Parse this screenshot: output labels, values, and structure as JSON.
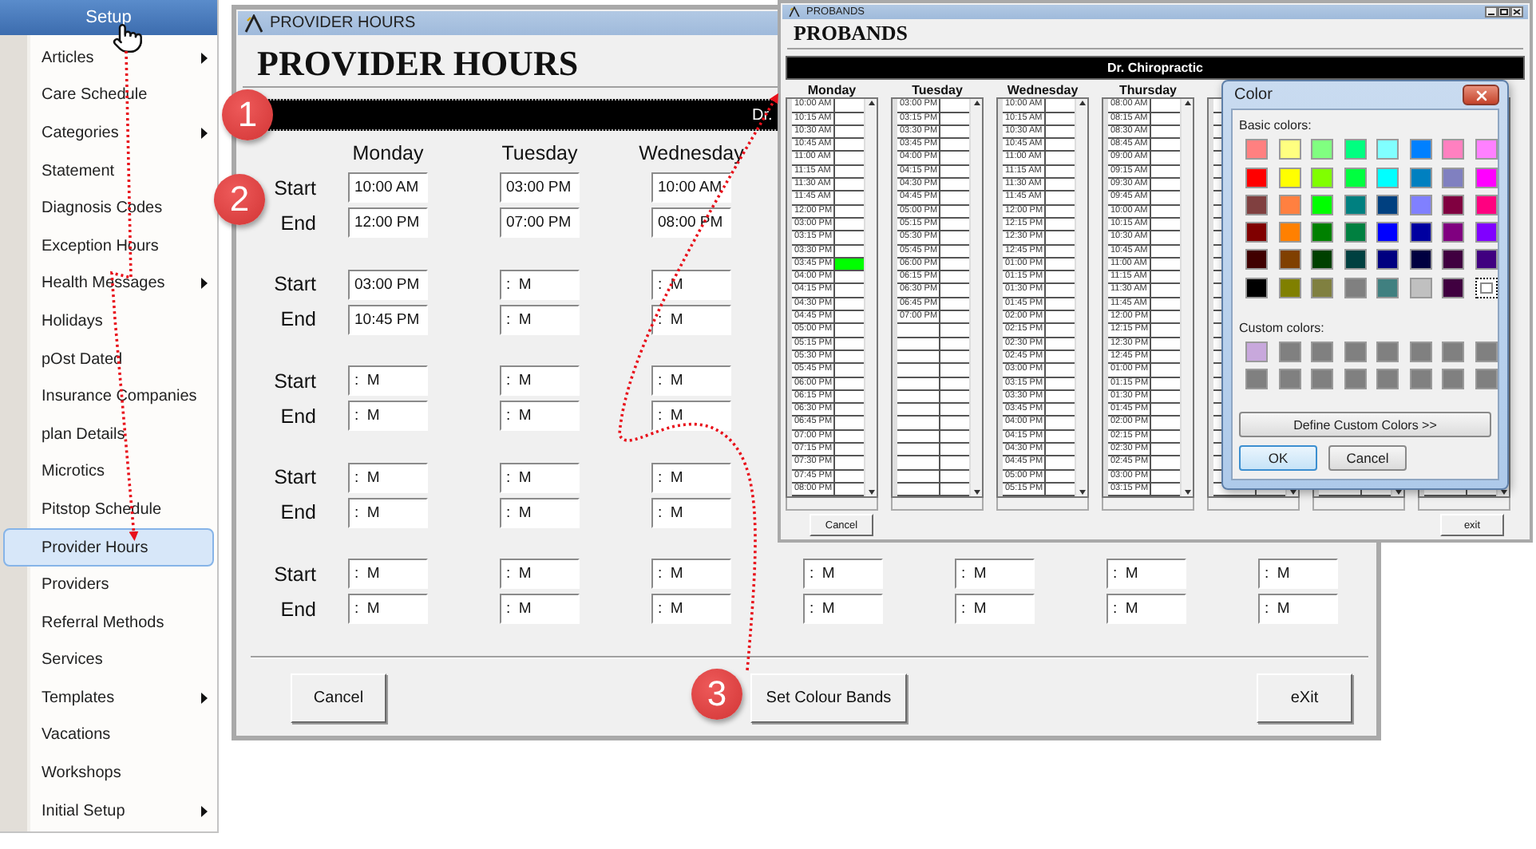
{
  "menu": {
    "title": "Setup",
    "items": [
      {
        "label": "Articles",
        "submenu": true,
        "selected": false
      },
      {
        "label": "Care Schedule",
        "submenu": false,
        "selected": false
      },
      {
        "label": "Categories",
        "submenu": true,
        "selected": false
      },
      {
        "label": "Statement",
        "submenu": false,
        "selected": false
      },
      {
        "label": "Diagnosis Codes",
        "submenu": false,
        "selected": false
      },
      {
        "label": "Exception Hours",
        "submenu": false,
        "selected": false
      },
      {
        "label": "Health Messages",
        "submenu": true,
        "selected": false
      },
      {
        "label": "Holidays",
        "submenu": false,
        "selected": false
      },
      {
        "label": "pOst Dated",
        "submenu": false,
        "selected": false
      },
      {
        "label": "Insurance Companies",
        "submenu": false,
        "selected": false
      },
      {
        "label": "plan Details",
        "submenu": false,
        "selected": false
      },
      {
        "label": "Microtics",
        "submenu": false,
        "selected": false
      },
      {
        "label": "Pitstop Schedule",
        "submenu": false,
        "selected": false
      },
      {
        "label": "Provider Hours",
        "submenu": false,
        "selected": true
      },
      {
        "label": "Providers",
        "submenu": false,
        "selected": false
      },
      {
        "label": "Referral Methods",
        "submenu": false,
        "selected": false
      },
      {
        "label": "Services",
        "submenu": false,
        "selected": false
      },
      {
        "label": "Templates",
        "submenu": true,
        "selected": false
      },
      {
        "label": "Vacations",
        "submenu": false,
        "selected": false
      },
      {
        "label": "Workshops",
        "submenu": false,
        "selected": false
      },
      {
        "label": "Initial Setup",
        "submenu": true,
        "selected": false
      }
    ]
  },
  "provider_hours": {
    "window_title": "PROVIDER HOURS",
    "heading": "PROVIDER HOURS",
    "band_text": "Dr.",
    "days": [
      "Monday",
      "Tuesday",
      "Wednesday"
    ],
    "slots": [
      {
        "start_label": "Start",
        "end_label": "End",
        "start": [
          "10:00 AM",
          "03:00 PM",
          "10:00 AM"
        ],
        "end": [
          "12:00 PM",
          "07:00 PM",
          "08:00 PM"
        ]
      },
      {
        "start_label": "Start",
        "end_label": "End",
        "start": [
          "03:00 PM",
          ":  M",
          ":  M"
        ],
        "end": [
          "10:45 PM",
          ":  M",
          ":  M"
        ]
      },
      {
        "start_label": "Start",
        "end_label": "End",
        "start": [
          ":  M",
          ":  M",
          ":  M"
        ],
        "end": [
          ":  M",
          ":  M",
          ":  M"
        ]
      },
      {
        "start_label": "Start",
        "end_label": "End",
        "start": [
          ":  M",
          ":  M",
          ":  M"
        ],
        "end": [
          ":  M",
          ":  M",
          ":  M"
        ]
      },
      {
        "start_label": "Start",
        "end_label": "End",
        "start": [
          ":  M",
          ":  M",
          ":  M",
          ":  M",
          ":  M",
          ":  M",
          ":  M"
        ],
        "end": [
          ":  M",
          ":  M",
          ":  M",
          ":  M",
          ":  M",
          ":  M",
          ":  M"
        ]
      }
    ],
    "buttons": [
      "Cancel",
      "Set Colour Bands",
      "eXit"
    ]
  },
  "probands": {
    "window_title": "PROBANDS",
    "heading": "PROBANDS",
    "band_text": "Dr. Chiropractic",
    "columns": [
      {
        "day": "Monday",
        "slots": [
          {
            "time": "10:00 AM"
          },
          {
            "time": "10:15 AM"
          },
          {
            "time": "10:30 AM"
          },
          {
            "time": "10:45 AM"
          },
          {
            "time": "11:00 AM"
          },
          {
            "time": "11:15 AM"
          },
          {
            "time": "11:30 AM"
          },
          {
            "time": "11:45 AM"
          },
          {
            "time": "12:00 PM"
          },
          {
            "time": "03:00 PM"
          },
          {
            "time": "03:15 PM"
          },
          {
            "time": "03:30 PM"
          },
          {
            "time": "03:45 PM",
            "color": "#00ff00"
          },
          {
            "time": "04:00 PM"
          },
          {
            "time": "04:15 PM"
          },
          {
            "time": "04:30 PM"
          },
          {
            "time": "04:45 PM"
          },
          {
            "time": "05:00 PM"
          },
          {
            "time": "05:15 PM"
          },
          {
            "time": "05:30 PM"
          },
          {
            "time": "05:45 PM"
          },
          {
            "time": "06:00 PM"
          },
          {
            "time": "06:15 PM"
          },
          {
            "time": "06:30 PM"
          },
          {
            "time": "06:45 PM"
          },
          {
            "time": "07:00 PM"
          },
          {
            "time": "07:15 PM"
          },
          {
            "time": "07:30 PM"
          },
          {
            "time": "07:45 PM"
          },
          {
            "time": "08:00 PM"
          }
        ]
      },
      {
        "day": "Tuesday",
        "slots": [
          {
            "time": "03:00 PM"
          },
          {
            "time": "03:15 PM"
          },
          {
            "time": "03:30 PM"
          },
          {
            "time": "03:45 PM"
          },
          {
            "time": "04:00 PM"
          },
          {
            "time": "04:15 PM"
          },
          {
            "time": "04:30 PM"
          },
          {
            "time": "04:45 PM"
          },
          {
            "time": "05:00 PM"
          },
          {
            "time": "05:15 PM"
          },
          {
            "time": "05:30 PM"
          },
          {
            "time": "05:45 PM"
          },
          {
            "time": "06:00 PM"
          },
          {
            "time": "06:15 PM"
          },
          {
            "time": "06:30 PM"
          },
          {
            "time": "06:45 PM"
          },
          {
            "time": "07:00 PM"
          }
        ]
      },
      {
        "day": "Wednesday",
        "slots": [
          {
            "time": "10:00 AM"
          },
          {
            "time": "10:15 AM"
          },
          {
            "time": "10:30 AM"
          },
          {
            "time": "10:45 AM"
          },
          {
            "time": "11:00 AM"
          },
          {
            "time": "11:15 AM"
          },
          {
            "time": "11:30 AM"
          },
          {
            "time": "11:45 AM"
          },
          {
            "time": "12:00 PM"
          },
          {
            "time": "12:15 PM"
          },
          {
            "time": "12:30 PM"
          },
          {
            "time": "12:45 PM"
          },
          {
            "time": "01:00 PM"
          },
          {
            "time": "01:15 PM"
          },
          {
            "time": "01:30 PM"
          },
          {
            "time": "01:45 PM"
          },
          {
            "time": "02:00 PM"
          },
          {
            "time": "02:15 PM"
          },
          {
            "time": "02:30 PM"
          },
          {
            "time": "02:45 PM"
          },
          {
            "time": "03:00 PM"
          },
          {
            "time": "03:15 PM"
          },
          {
            "time": "03:30 PM"
          },
          {
            "time": "03:45 PM"
          },
          {
            "time": "04:00 PM"
          },
          {
            "time": "04:15 PM"
          },
          {
            "time": "04:30 PM"
          },
          {
            "time": "04:45 PM"
          },
          {
            "time": "05:00 PM"
          },
          {
            "time": "05:15 PM"
          }
        ]
      },
      {
        "day": "Thursday",
        "slots": [
          {
            "time": "08:00 AM"
          },
          {
            "time": "08:15 AM"
          },
          {
            "time": "08:30 AM"
          },
          {
            "time": "08:45 AM"
          },
          {
            "time": "09:00 AM"
          },
          {
            "time": "09:15 AM"
          },
          {
            "time": "09:30 AM"
          },
          {
            "time": "09:45 AM"
          },
          {
            "time": "10:00 AM"
          },
          {
            "time": "10:15 AM"
          },
          {
            "time": "10:30 AM"
          },
          {
            "time": "10:45 AM"
          },
          {
            "time": "11:00 AM"
          },
          {
            "time": "11:15 AM"
          },
          {
            "time": "11:30 AM"
          },
          {
            "time": "11:45 AM"
          },
          {
            "time": "12:00 PM"
          },
          {
            "time": "12:15 PM"
          },
          {
            "time": "12:30 PM"
          },
          {
            "time": "12:45 PM"
          },
          {
            "time": "01:00 PM"
          },
          {
            "time": "01:15 PM"
          },
          {
            "time": "01:30 PM"
          },
          {
            "time": "01:45 PM"
          },
          {
            "time": "02:00 PM"
          },
          {
            "time": "02:15 PM"
          },
          {
            "time": "02:30 PM"
          },
          {
            "time": "02:45 PM"
          },
          {
            "time": "03:00 PM"
          },
          {
            "time": "03:15 PM"
          }
        ]
      }
    ],
    "buttons": [
      "Cancel",
      "exit"
    ]
  },
  "color_dialog": {
    "title": "Color",
    "basic_label": "Basic colors:",
    "basic_colors": [
      {
        "color": "#ff8080",
        "selected": false
      },
      {
        "color": "#ffff80",
        "selected": false
      },
      {
        "color": "#80ff80",
        "selected": false
      },
      {
        "color": "#00ff80",
        "selected": false
      },
      {
        "color": "#80ffff",
        "selected": false
      },
      {
        "color": "#0080ff",
        "selected": false
      },
      {
        "color": "#ff80c0",
        "selected": false
      },
      {
        "color": "#ff80ff",
        "selected": false
      },
      {
        "color": "#ff0000",
        "selected": false
      },
      {
        "color": "#ffff00",
        "selected": false
      },
      {
        "color": "#80ff00",
        "selected": false
      },
      {
        "color": "#00ff40",
        "selected": false
      },
      {
        "color": "#00ffff",
        "selected": false
      },
      {
        "color": "#0080c0",
        "selected": false
      },
      {
        "color": "#8080c0",
        "selected": false
      },
      {
        "color": "#ff00ff",
        "selected": false
      },
      {
        "color": "#804040",
        "selected": false
      },
      {
        "color": "#ff8040",
        "selected": false
      },
      {
        "color": "#00ff00",
        "selected": false
      },
      {
        "color": "#008080",
        "selected": false
      },
      {
        "color": "#004080",
        "selected": false
      },
      {
        "color": "#8080ff",
        "selected": false
      },
      {
        "color": "#800040",
        "selected": false
      },
      {
        "color": "#ff0080",
        "selected": false
      },
      {
        "color": "#800000",
        "selected": false
      },
      {
        "color": "#ff8000",
        "selected": false
      },
      {
        "color": "#008000",
        "selected": false
      },
      {
        "color": "#008040",
        "selected": false
      },
      {
        "color": "#0000ff",
        "selected": false
      },
      {
        "color": "#0000a0",
        "selected": false
      },
      {
        "color": "#800080",
        "selected": false
      },
      {
        "color": "#8000ff",
        "selected": false
      },
      {
        "color": "#400000",
        "selected": false
      },
      {
        "color": "#804000",
        "selected": false
      },
      {
        "color": "#004000",
        "selected": false
      },
      {
        "color": "#004040",
        "selected": false
      },
      {
        "color": "#000080",
        "selected": false
      },
      {
        "color": "#000040",
        "selected": false
      },
      {
        "color": "#400040",
        "selected": false
      },
      {
        "color": "#400080",
        "selected": false
      },
      {
        "color": "#000000",
        "selected": false
      },
      {
        "color": "#808000",
        "selected": false
      },
      {
        "color": "#808040",
        "selected": false
      },
      {
        "color": "#808080",
        "selected": false
      },
      {
        "color": "#408080",
        "selected": false
      },
      {
        "color": "#c0c0c0",
        "selected": false
      },
      {
        "color": "#400040",
        "selected": false
      },
      {
        "color": "#ffffff",
        "selected": true
      }
    ],
    "custom_label": "Custom colors:",
    "custom_colors": [
      {
        "color": "#c8a8dc"
      },
      {
        "color": "#808080"
      },
      {
        "color": "#808080"
      },
      {
        "color": "#808080"
      },
      {
        "color": "#808080"
      },
      {
        "color": "#808080"
      },
      {
        "color": "#808080"
      },
      {
        "color": "#808080"
      },
      {
        "color": "#808080"
      },
      {
        "color": "#808080"
      },
      {
        "color": "#808080"
      },
      {
        "color": "#808080"
      },
      {
        "color": "#808080"
      },
      {
        "color": "#808080"
      },
      {
        "color": "#808080"
      },
      {
        "color": "#808080"
      }
    ],
    "define_button": "Define Custom Colors >>",
    "ok_button": "OK",
    "cancel_button": "Cancel"
  },
  "callouts": [
    "1",
    "2",
    "3"
  ]
}
